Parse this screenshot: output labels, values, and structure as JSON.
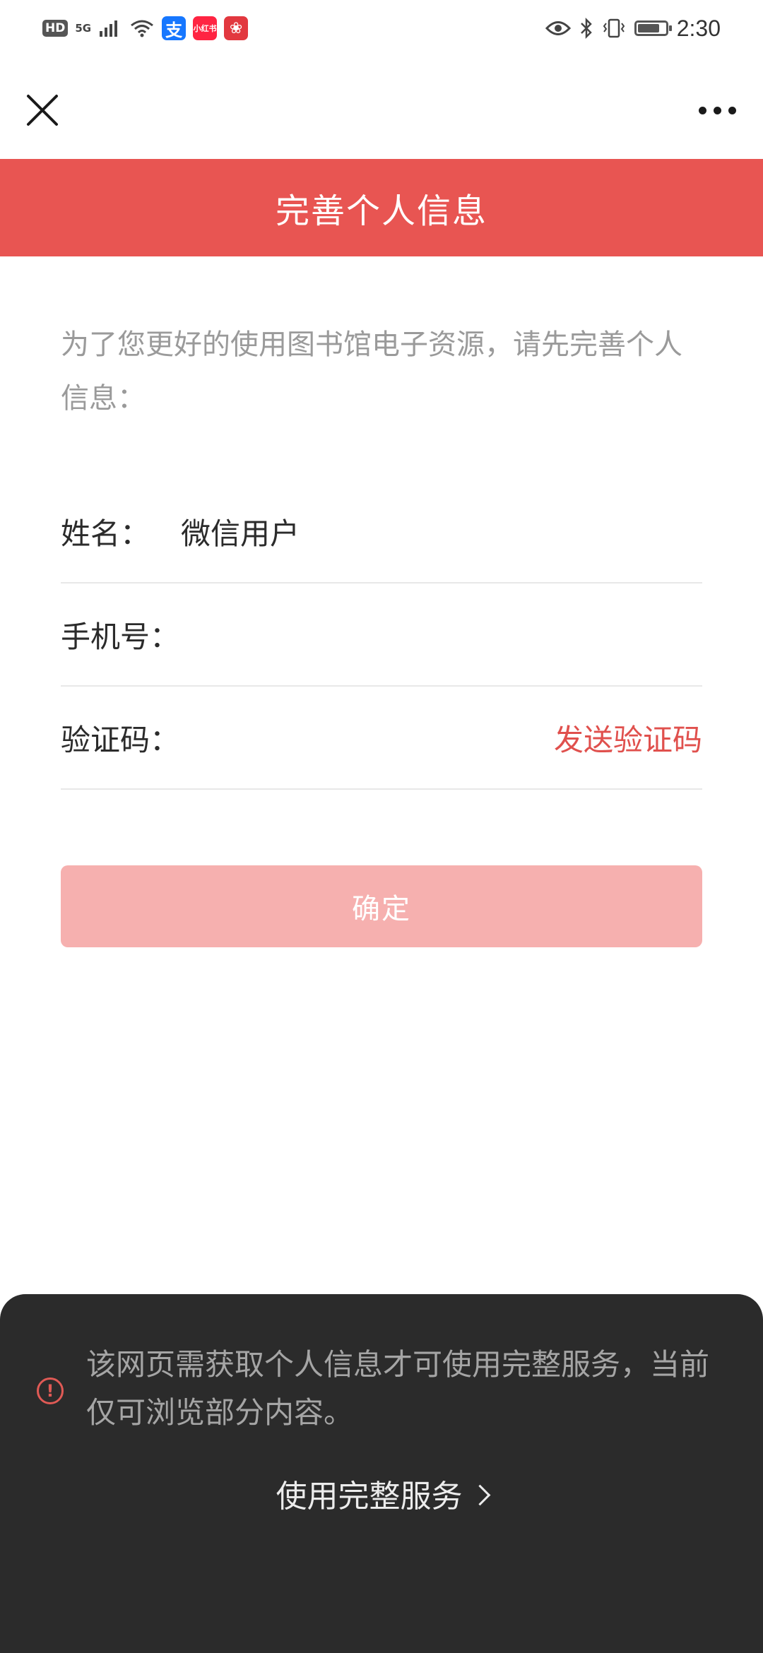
{
  "status_bar": {
    "hd": "HD",
    "network": "5G",
    "apps": [
      {
        "name": "alipay-icon",
        "glyph": "支"
      },
      {
        "name": "xiaohongshu-icon",
        "glyph": "小红书"
      },
      {
        "name": "app-red-icon",
        "glyph": "❀"
      }
    ],
    "time": "2:30",
    "battery_level": 0.8
  },
  "header": {
    "title": "完善个人信息"
  },
  "intro": "为了您更好的使用图书馆电子资源，请先完善个人信息：",
  "form": {
    "name_label": "姓名：",
    "name_value": "微信用户",
    "phone_label": "手机号：",
    "phone_value": "",
    "code_label": "验证码：",
    "code_value": "",
    "send_code": "发送验证码",
    "confirm": "确定"
  },
  "sheet": {
    "message": "该网页需获取个人信息才可使用完整服务，当前仅可浏览部分内容。",
    "action": "使用完整服务"
  },
  "colors": {
    "brand_red": "#e85552",
    "button_disabled": "#f6b0af",
    "link_red": "#e0504d",
    "sheet_bg": "#2b2b2b"
  }
}
